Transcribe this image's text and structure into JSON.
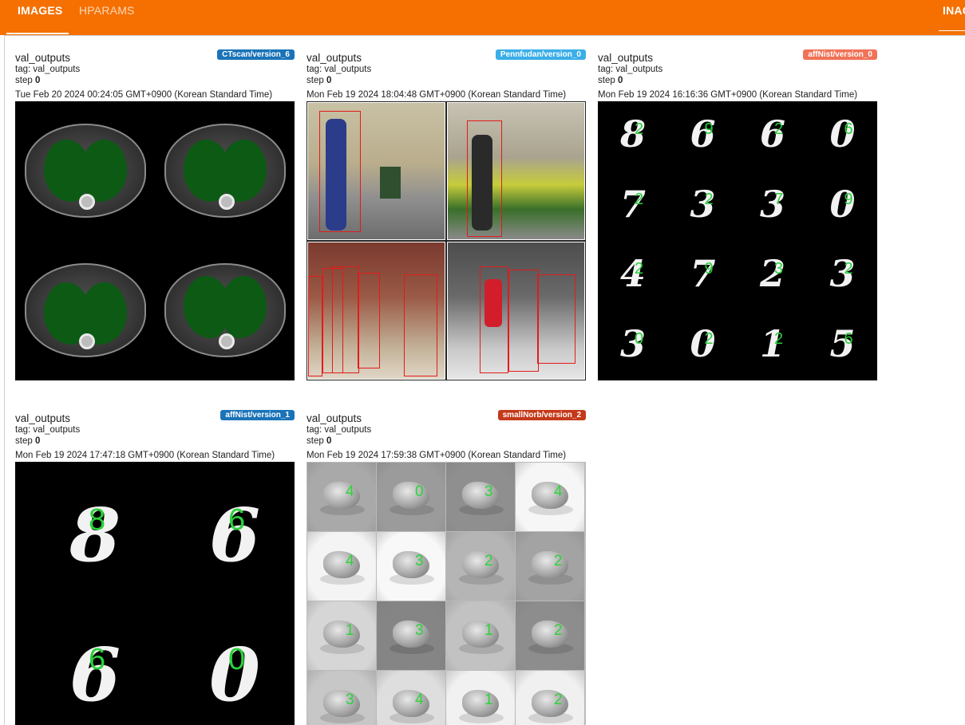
{
  "header": {
    "tabs": [
      {
        "label": "IMAGES",
        "active": true
      },
      {
        "label": "HPARAMS",
        "active": false
      },
      {
        "label": "INAG",
        "active": false
      }
    ],
    "bar_color": "#f57000"
  },
  "cards": [
    {
      "title": "val_outputs",
      "run": "CTscan/version_6",
      "run_color": "#1a73b8",
      "tag": "tag: val_outputs",
      "step_label": "step",
      "step_value": "0",
      "timestamp": "Tue Feb 20 2024 00:24:05 GMT+0900 (Korean Standard Time)"
    },
    {
      "title": "val_outputs",
      "run": "Pennfudan/version_0",
      "run_color": "#3aaee8",
      "tag": "tag: val_outputs",
      "step_label": "step",
      "step_value": "0",
      "timestamp": "Mon Feb 19 2024 18:04:48 GMT+0900 (Korean Standard Time)"
    },
    {
      "title": "val_outputs",
      "run": "affNist/version_0",
      "run_color": "#f07257",
      "tag": "tag: val_outputs",
      "step_label": "step",
      "step_value": "0",
      "timestamp": "Mon Feb 19 2024 16:16:36 GMT+0900 (Korean Standard Time)",
      "digit_grid": [
        {
          "digit": "8",
          "label": "2"
        },
        {
          "digit": "6",
          "label": "9"
        },
        {
          "digit": "6",
          "label": "2"
        },
        {
          "digit": "0",
          "label": "6"
        },
        {
          "digit": "7",
          "label": "2"
        },
        {
          "digit": "3",
          "label": "2"
        },
        {
          "digit": "3",
          "label": "7"
        },
        {
          "digit": "0",
          "label": "9"
        },
        {
          "digit": "4",
          "label": "2"
        },
        {
          "digit": "7",
          "label": "9"
        },
        {
          "digit": "2",
          "label": "3"
        },
        {
          "digit": "3",
          "label": "2"
        },
        {
          "digit": "3",
          "label": "0"
        },
        {
          "digit": "0",
          "label": "2"
        },
        {
          "digit": "1",
          "label": "2"
        },
        {
          "digit": "5",
          "label": "6"
        }
      ]
    },
    {
      "title": "val_outputs",
      "run": "affNist/version_1",
      "run_color": "#1a73b8",
      "tag": "tag: val_outputs",
      "step_label": "step",
      "step_value": "0",
      "timestamp": "Mon Feb 19 2024 17:47:18 GMT+0900 (Korean Standard Time)",
      "digit_grid": [
        {
          "digit": "8",
          "label": "8"
        },
        {
          "digit": "6",
          "label": "6"
        },
        {
          "digit": "6",
          "label": "6"
        },
        {
          "digit": "0",
          "label": "0"
        }
      ]
    },
    {
      "title": "val_outputs",
      "run": "smallNorb/version_2",
      "run_color": "#c4391a",
      "tag": "tag: val_outputs",
      "step_label": "step",
      "step_value": "0",
      "timestamp": "Mon Feb 19 2024 17:59:38 GMT+0900 (Korean Standard Time)",
      "norb_labels": [
        "4",
        "0",
        "3",
        "4",
        "4",
        "3",
        "2",
        "2",
        "1",
        "3",
        "1",
        "2",
        "3",
        "4",
        "1",
        "2"
      ]
    }
  ]
}
